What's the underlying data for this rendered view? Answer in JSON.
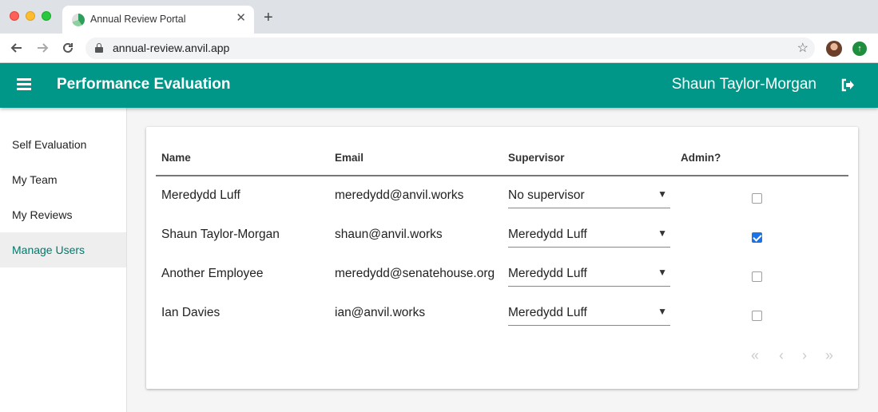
{
  "browser": {
    "tab_title": "Annual Review Portal",
    "tab_close": "✕",
    "new_tab": "+",
    "url": "annual-review.anvil.app"
  },
  "header": {
    "title": "Performance Evaluation",
    "user_name": "Shaun Taylor-Morgan",
    "color": "#009688"
  },
  "sidebar": {
    "items": [
      {
        "label": "Self Evaluation",
        "active": false
      },
      {
        "label": "My Team",
        "active": false
      },
      {
        "label": "My Reviews",
        "active": false
      },
      {
        "label": "Manage Users",
        "active": true
      }
    ]
  },
  "table": {
    "columns": [
      "Name",
      "Email",
      "Supervisor",
      "Admin?"
    ],
    "rows": [
      {
        "name": "Meredydd Luff",
        "email": "meredydd@anvil.works",
        "supervisor": "No supervisor",
        "admin": false
      },
      {
        "name": "Shaun Taylor-Morgan",
        "email": "shaun@anvil.works",
        "supervisor": "Meredydd Luff",
        "admin": true
      },
      {
        "name": "Another Employee",
        "email": "meredydd@senatehouse.org",
        "supervisor": "Meredydd Luff",
        "admin": false
      },
      {
        "name": "Ian Davies",
        "email": "ian@anvil.works",
        "supervisor": "Meredydd Luff",
        "admin": false
      }
    ]
  },
  "icons": {
    "menu": "hamburger-icon",
    "logout": "logout-icon",
    "pager": [
      "first-page-icon",
      "prev-page-icon",
      "next-page-icon",
      "last-page-icon"
    ]
  }
}
